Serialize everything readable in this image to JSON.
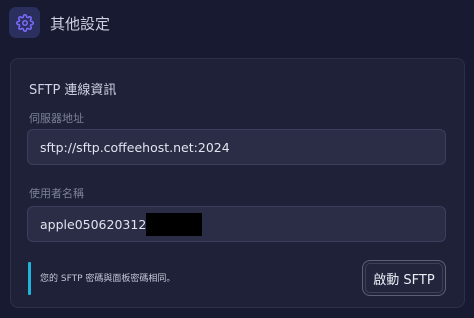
{
  "header": {
    "icon": "gear-icon",
    "title": "其他設定"
  },
  "sftp": {
    "title": "SFTP 連線資訊",
    "server": {
      "label": "伺服器地址",
      "value": "sftp://sftp.coffeehost.net:2024"
    },
    "username": {
      "label": "使用者名稱",
      "value": "apple050620312"
    },
    "note": "您的 SFTP 密碼與面板密碼相同。",
    "start_button": "啟動 SFTP"
  },
  "colors": {
    "background": "#171a30",
    "card": "#1e2137",
    "accent_bar": "#20b5d8",
    "icon": "#7b6cff"
  }
}
